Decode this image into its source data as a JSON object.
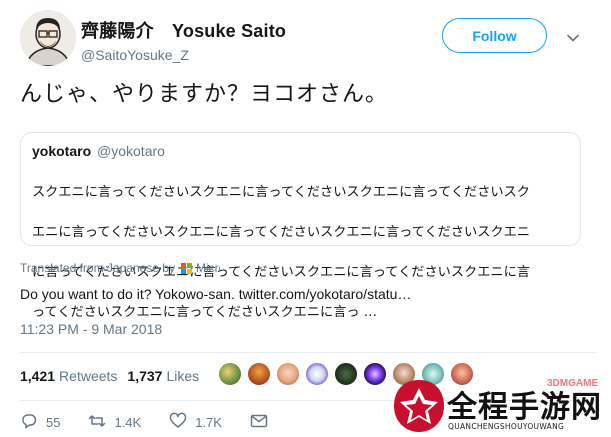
{
  "header": {
    "display_name": "齊藤陽介　Yosuke Saito",
    "handle": "@SaitoYosuke_Z",
    "follow_label": "Follow"
  },
  "tweet": {
    "text": "んじゃ、やりますか？ヨコオさん。"
  },
  "quote": {
    "name": "yokotaro",
    "handle": "@yokotaro",
    "lines": [
      "スクエニに言ってくださいスクエニに言ってくださいスクエニに言ってくださいスク",
      "エニに言ってくださいスクエニに言ってくださいスクエニに言ってくださいスクエニ",
      "に言ってくださいスクエニに言ってくださいスクエニに言ってくださいスクエニに言",
      "ってくださいスクエニに言ってくださいスクエニに言っ …"
    ]
  },
  "translation": {
    "label": "Translated from Japanese by",
    "provider": "Micros",
    "text": "Do you want to do it? Yokowo-san. twitter.com/yokotaro/statu…"
  },
  "timestamp": "11:23 PM - 9 Mar 2018",
  "stats": {
    "retweets_count": "1,421",
    "retweets_label": "Retweets",
    "likes_count": "1,737",
    "likes_label": "Likes"
  },
  "actions": {
    "replies": "55",
    "retweets": "1.4K",
    "likes": "1.7K"
  },
  "watermark": {
    "title": "全程手游网",
    "subtitle": "QUANCHENGSHOUYOUWANG",
    "tag": "3DMGAME"
  },
  "colors": {
    "accent": "#1da1f2",
    "secondary_text": "#657786",
    "border": "#e1e8ed",
    "watermark_red": "#c8102e"
  }
}
